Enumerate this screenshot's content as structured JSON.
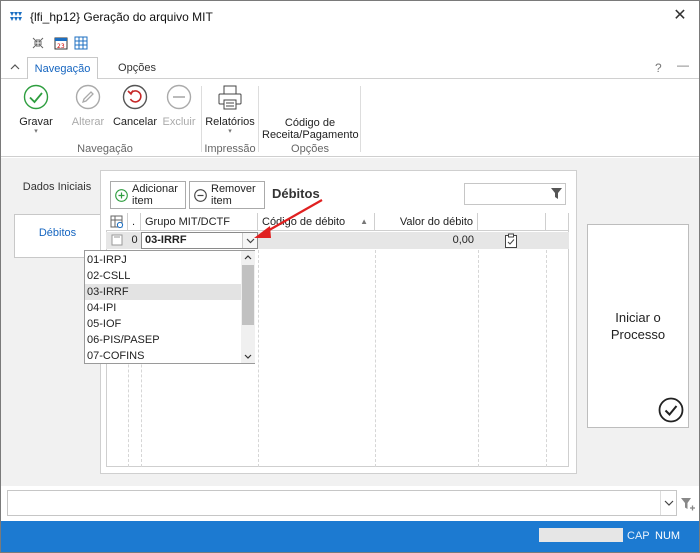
{
  "window": {
    "title": "{lfi_hp12}  Geração do arquivo MIT",
    "close_glyph": "✕"
  },
  "ribbon": {
    "tabs": [
      {
        "label": "Navegação"
      },
      {
        "label": "Opções"
      }
    ],
    "help": "?",
    "minimize": "—",
    "buttons": {
      "gravar": "Gravar",
      "alterar": "Alterar",
      "cancelar": "Cancelar",
      "excluir": "Excluir",
      "relatorios": "Relatórios",
      "codigo": "Código de Receita/Pagamento"
    },
    "groups": {
      "navegacao": "Navegação",
      "impressao": "Impressão",
      "opcoes": "Opções"
    }
  },
  "sidetabs": [
    {
      "label": "Dados Iniciais"
    },
    {
      "label": "Débitos"
    }
  ],
  "toolbar": {
    "add": "Adicionar item",
    "remove": "Remover item",
    "title": "Débitos"
  },
  "grid": {
    "headers": {
      "dot": ".",
      "grupo": "Grupo MIT/DCTF",
      "codigo": "Código de débito",
      "valor": "Valor do débito"
    },
    "row": {
      "index": "0",
      "grupo": "03-IRRF",
      "valor": "0,00"
    }
  },
  "dropdown": {
    "options": [
      "01-IRPJ",
      "02-CSLL",
      "03-IRRF",
      "04-IPI",
      "05-IOF",
      "06-PIS/PASEP",
      "07-COFINS"
    ],
    "selected": "03-IRRF"
  },
  "action": {
    "label": "Iniciar o Processo"
  },
  "status": {
    "cap": "CAP",
    "num": "NUM"
  },
  "colors": {
    "accent": "#1565c0",
    "status_bar": "#1c7ad1",
    "gravar_green": "#2e9e3f",
    "cancel_red": "#c62828",
    "arrow_red": "#e02020"
  }
}
